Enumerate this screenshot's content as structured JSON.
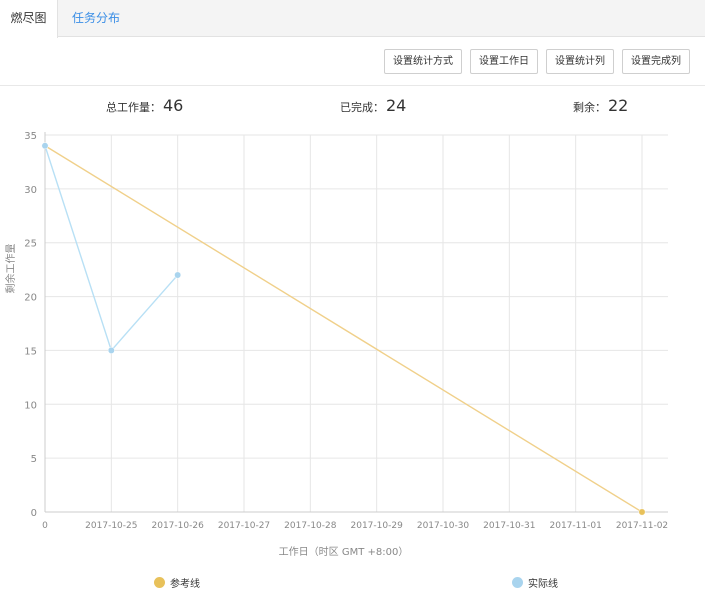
{
  "tabs": [
    {
      "label": "燃尽图",
      "active": true
    },
    {
      "label": "任务分布",
      "active": false
    }
  ],
  "toolbar": {
    "buttons": [
      "设置统计方式",
      "设置工作日",
      "设置统计列",
      "设置完成列"
    ]
  },
  "stats": {
    "total_label": "总工作量：",
    "total_value": "46",
    "done_label": "已完成：",
    "done_value": "24",
    "remain_label": "剩余：",
    "remain_value": "22"
  },
  "colors": {
    "reference": "#e8c15a",
    "reference_line": "#f0d08a",
    "actual": "#a9d4ee",
    "actual_line": "#b8e0f5",
    "grid": "#e6e6e6",
    "axis": "#cccccc"
  },
  "chart_data": {
    "type": "line",
    "title": "",
    "xlabel": "工作日（时区 GMT +8:00）",
    "ylabel": "剩余工作量",
    "x_ticks": [
      "0",
      "2017-10-25",
      "2017-10-26",
      "2017-10-27",
      "2017-10-28",
      "2017-10-29",
      "2017-10-30",
      "2017-10-31",
      "2017-11-01",
      "2017-11-02"
    ],
    "y_ticks": [
      0,
      5,
      10,
      15,
      20,
      25,
      30,
      35
    ],
    "ylim": [
      0,
      35
    ],
    "grid": true,
    "legend_position": "bottom",
    "series": [
      {
        "name": "参考线",
        "x": [
          "0",
          "2017-11-02"
        ],
        "values": [
          34,
          0
        ]
      },
      {
        "name": "实际线",
        "x": [
          "0",
          "2017-10-25",
          "2017-10-26"
        ],
        "values": [
          34,
          15,
          22
        ]
      }
    ]
  }
}
